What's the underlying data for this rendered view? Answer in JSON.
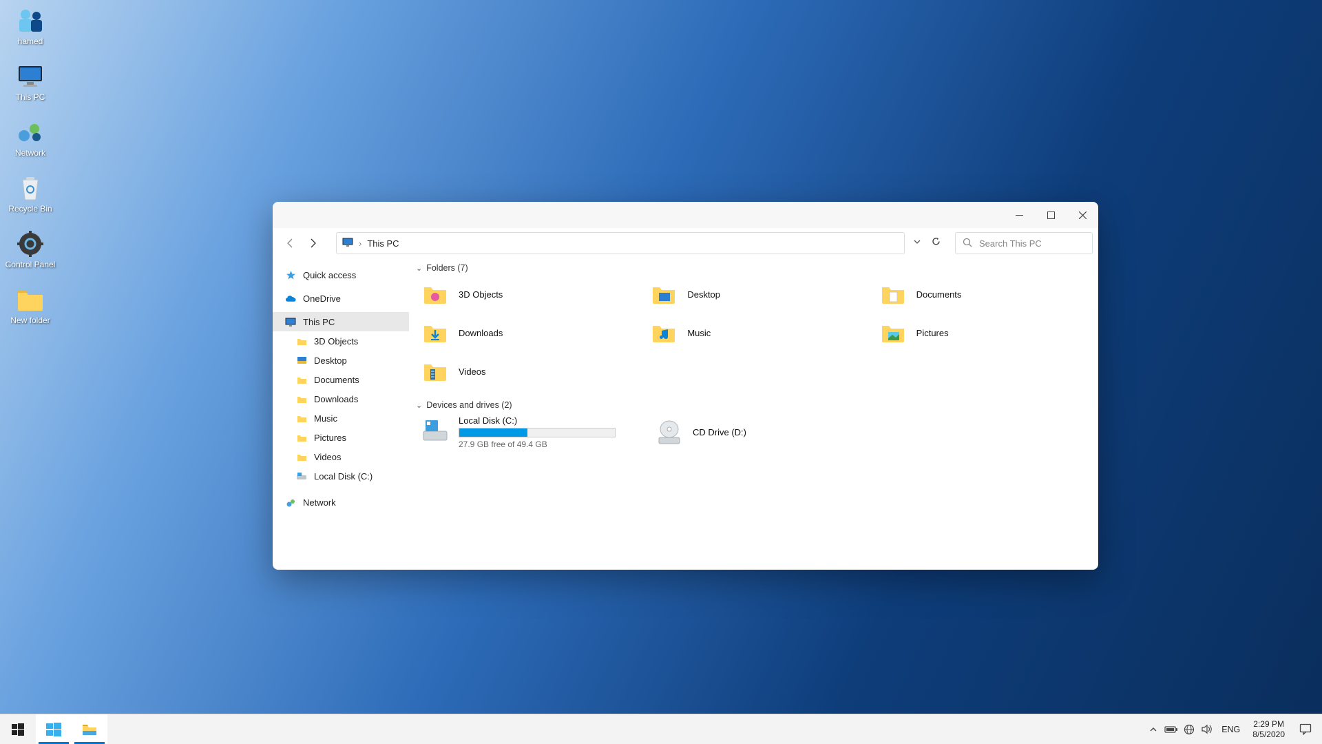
{
  "desktop": {
    "icons": [
      {
        "id": "user",
        "label": "hamed"
      },
      {
        "id": "this-pc",
        "label": "This PC"
      },
      {
        "id": "network",
        "label": "Network"
      },
      {
        "id": "recycle-bin",
        "label": "Recycle Bin"
      },
      {
        "id": "control-panel",
        "label": "Control Panel"
      },
      {
        "id": "new-folder",
        "label": "New folder"
      }
    ]
  },
  "explorer": {
    "breadcrumb": "This PC",
    "search_placeholder": "Search This PC",
    "nav": {
      "quick_access": "Quick access",
      "onedrive": "OneDrive",
      "this_pc": "This PC",
      "children": [
        "3D Objects",
        "Desktop",
        "Documents",
        "Downloads",
        "Music",
        "Pictures",
        "Videos",
        "Local Disk (C:)"
      ],
      "network": "Network"
    },
    "groups": {
      "folders_header": "Folders (7)",
      "drives_header": "Devices and drives (2)"
    },
    "folders": [
      "3D Objects",
      "Desktop",
      "Documents",
      "Downloads",
      "Music",
      "Pictures",
      "Videos"
    ],
    "drives": {
      "c": {
        "name": "Local Disk (C:)",
        "sub": "27.9 GB free of 49.4 GB",
        "used_pct": 44
      },
      "d": {
        "name": "CD Drive (D:)"
      }
    }
  },
  "taskbar": {
    "lang": "ENG",
    "time": "2:29 PM",
    "date": "8/5/2020"
  }
}
